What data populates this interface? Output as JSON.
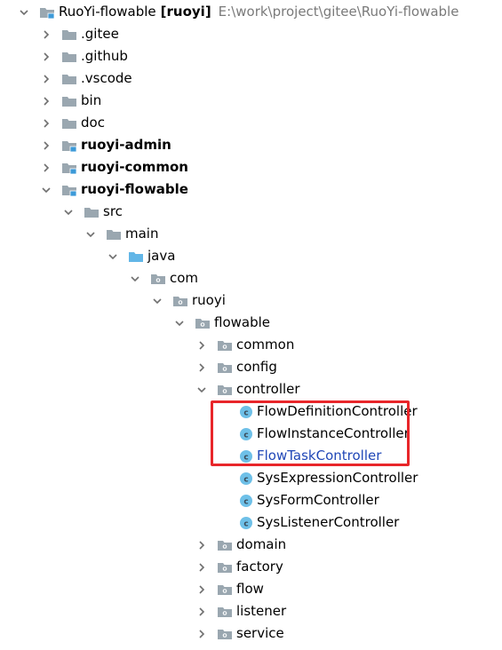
{
  "root": {
    "name": "RuoYi-flowable",
    "qualifier": "[ruoyi]",
    "path": "E:\\work\\project\\gitee\\RuoYi-flowable"
  },
  "rows": [
    {
      "label": "RuoYi-flowable",
      "type": "module",
      "depth": 0,
      "arrow": "down",
      "bold": false
    },
    {
      "label": ".gitee",
      "type": "folder",
      "depth": 1,
      "arrow": "right"
    },
    {
      "label": ".github",
      "type": "folder",
      "depth": 1,
      "arrow": "right"
    },
    {
      "label": ".vscode",
      "type": "folder",
      "depth": 1,
      "arrow": "right"
    },
    {
      "label": "bin",
      "type": "folder",
      "depth": 1,
      "arrow": "right"
    },
    {
      "label": "doc",
      "type": "folder",
      "depth": 1,
      "arrow": "right"
    },
    {
      "label": "ruoyi-admin",
      "type": "module",
      "depth": 1,
      "arrow": "right",
      "bold": true
    },
    {
      "label": "ruoyi-common",
      "type": "module",
      "depth": 1,
      "arrow": "right",
      "bold": true
    },
    {
      "label": "ruoyi-flowable",
      "type": "module",
      "depth": 1,
      "arrow": "down",
      "bold": true
    },
    {
      "label": "src",
      "type": "folder",
      "depth": 2,
      "arrow": "down"
    },
    {
      "label": "main",
      "type": "folder",
      "depth": 3,
      "arrow": "down"
    },
    {
      "label": "java",
      "type": "source-folder",
      "depth": 4,
      "arrow": "down"
    },
    {
      "label": "com",
      "type": "package",
      "depth": 5,
      "arrow": "down"
    },
    {
      "label": "ruoyi",
      "type": "package",
      "depth": 6,
      "arrow": "down"
    },
    {
      "label": "flowable",
      "type": "package",
      "depth": 7,
      "arrow": "down"
    },
    {
      "label": "common",
      "type": "package",
      "depth": 8,
      "arrow": "right"
    },
    {
      "label": "config",
      "type": "package",
      "depth": 8,
      "arrow": "right"
    },
    {
      "label": "controller",
      "type": "package",
      "depth": 8,
      "arrow": "down"
    },
    {
      "label": "FlowDefinitionController",
      "type": "class",
      "depth": 9,
      "arrow": "none"
    },
    {
      "label": "FlowInstanceController",
      "type": "class",
      "depth": 9,
      "arrow": "none"
    },
    {
      "label": "FlowTaskController",
      "type": "class",
      "depth": 9,
      "arrow": "none",
      "link": true
    },
    {
      "label": "SysExpressionController",
      "type": "class",
      "depth": 9,
      "arrow": "none"
    },
    {
      "label": "SysFormController",
      "type": "class",
      "depth": 9,
      "arrow": "none"
    },
    {
      "label": "SysListenerController",
      "type": "class",
      "depth": 9,
      "arrow": "none"
    },
    {
      "label": "domain",
      "type": "package",
      "depth": 8,
      "arrow": "right"
    },
    {
      "label": "factory",
      "type": "package",
      "depth": 8,
      "arrow": "right"
    },
    {
      "label": "flow",
      "type": "package",
      "depth": 8,
      "arrow": "right"
    },
    {
      "label": "listener",
      "type": "package",
      "depth": 8,
      "arrow": "right"
    },
    {
      "label": "service",
      "type": "package",
      "depth": 8,
      "arrow": "right"
    }
  ],
  "colors": {
    "folder": "#9aa7b0",
    "module_badge": "#3c9ad8",
    "source_folder": "#62b6e7",
    "class_icon": "#6ec0e8",
    "highlight_border": "#e8262a",
    "link_text": "#2047b7",
    "path_text": "#7a7a7a"
  }
}
